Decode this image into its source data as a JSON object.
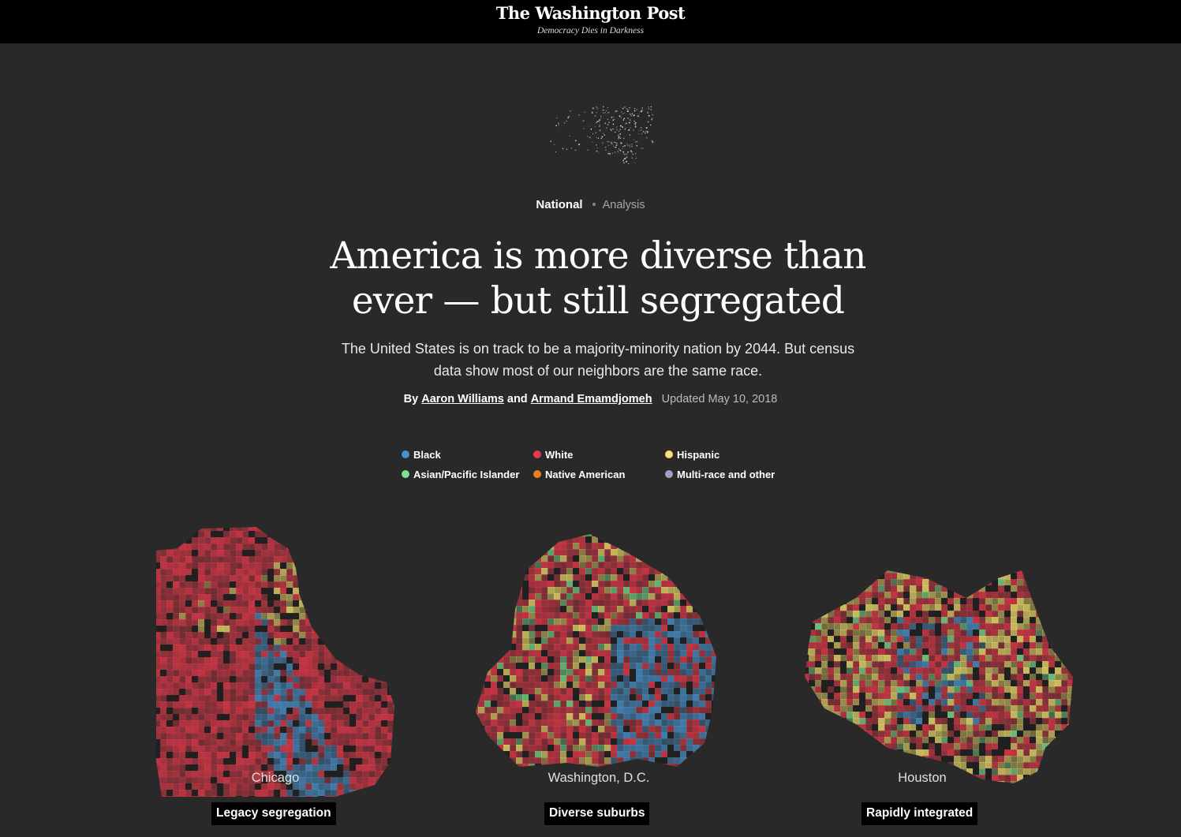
{
  "masthead": {
    "logo": "The Washington Post",
    "tagline": "Democracy Dies in Darkness"
  },
  "kicker": {
    "section": "National",
    "label": "Analysis"
  },
  "headline": {
    "line1": "America is more diverse than",
    "line2": "ever — but still segregated"
  },
  "dek": {
    "line1": "The United States is on track to be a majority-minority nation by 2044. But census",
    "line2": "data show most of our neighbors are the same race."
  },
  "byline": {
    "by": "By",
    "author1": "Aaron Williams",
    "and": "and",
    "author2": "Armand Emamdjomeh",
    "updated": "Updated May 10, 2018"
  },
  "legend": [
    {
      "label": "Black",
      "color": "#4a90c8"
    },
    {
      "label": "White",
      "color": "#e6394a"
    },
    {
      "label": "Hispanic",
      "color": "#f4e36d"
    },
    {
      "label": "Asian/Pacific Islander",
      "color": "#7ee08f"
    },
    {
      "label": "Native American",
      "color": "#ea7d1d"
    },
    {
      "label": "Multi-race and other",
      "color": "#a79ac4"
    }
  ],
  "maps": [
    {
      "city": "Chicago",
      "tag": "Legacy segregation"
    },
    {
      "city": "Washington, D.C.",
      "tag": "Diverse suburbs"
    },
    {
      "city": "Houston",
      "tag": "Rapidly integrated"
    }
  ]
}
